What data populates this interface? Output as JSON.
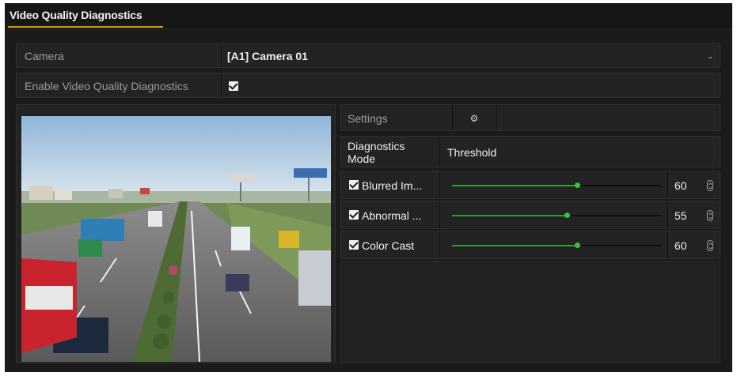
{
  "window": {
    "title": "Video Quality Diagnostics"
  },
  "camera": {
    "label": "Camera",
    "value": "[A1] Camera 01",
    "dropdown_icon": "chevron-down-icon"
  },
  "enable": {
    "label": "Enable Video Quality Diagnostics",
    "checked": true
  },
  "settings": {
    "label": "Settings",
    "button_icon": "gear-icon"
  },
  "diagnostics": {
    "mode_header": "Diagnostics Mode",
    "threshold_header": "Threshold",
    "items": [
      {
        "name": "Blurred Im...",
        "checked": true,
        "value": "60",
        "level": 60
      },
      {
        "name": "Abnormal ...",
        "checked": true,
        "value": "55",
        "level": 55
      },
      {
        "name": "Color Cast",
        "checked": true,
        "value": "60",
        "level": 60
      }
    ]
  },
  "colors": {
    "accent_underline": "#c9a400",
    "slider_fill": "#27a02d",
    "background": "#1b1b1b"
  }
}
